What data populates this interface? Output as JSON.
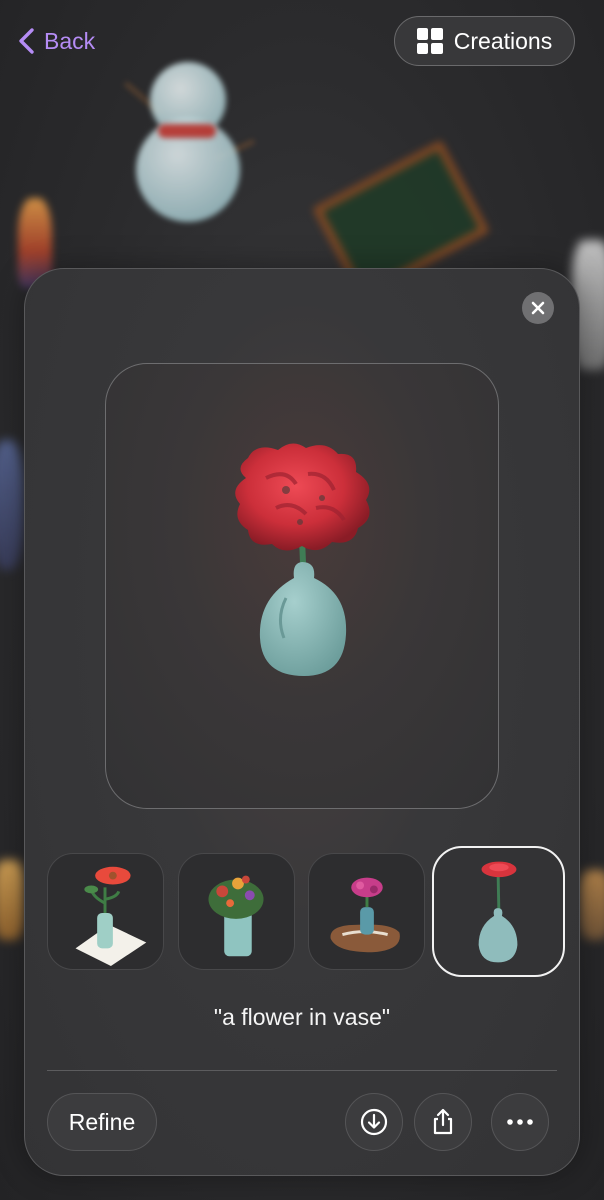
{
  "nav": {
    "back_label": "Back",
    "creations_label": "Creations"
  },
  "preview": {
    "prompt": "\"a flower in vase\""
  },
  "thumbnails": [
    {
      "subject": "gerbera in bottle vase on paper",
      "selected": false
    },
    {
      "subject": "bouquet in glass jar",
      "selected": false
    },
    {
      "subject": "pink flowers in small vase on wooden base",
      "selected": false
    },
    {
      "subject": "red flower in blue vase",
      "selected": true
    }
  ],
  "actions": {
    "refine_label": "Refine",
    "download_icon": "download-icon",
    "share_icon": "share-icon",
    "more_icon": "ellipsis-icon"
  },
  "colors": {
    "accent": "#b58cf5",
    "background": "#2a2a2c",
    "panel": "#38383a",
    "flower": "#d8343d",
    "vase": "#8fbcbc"
  }
}
